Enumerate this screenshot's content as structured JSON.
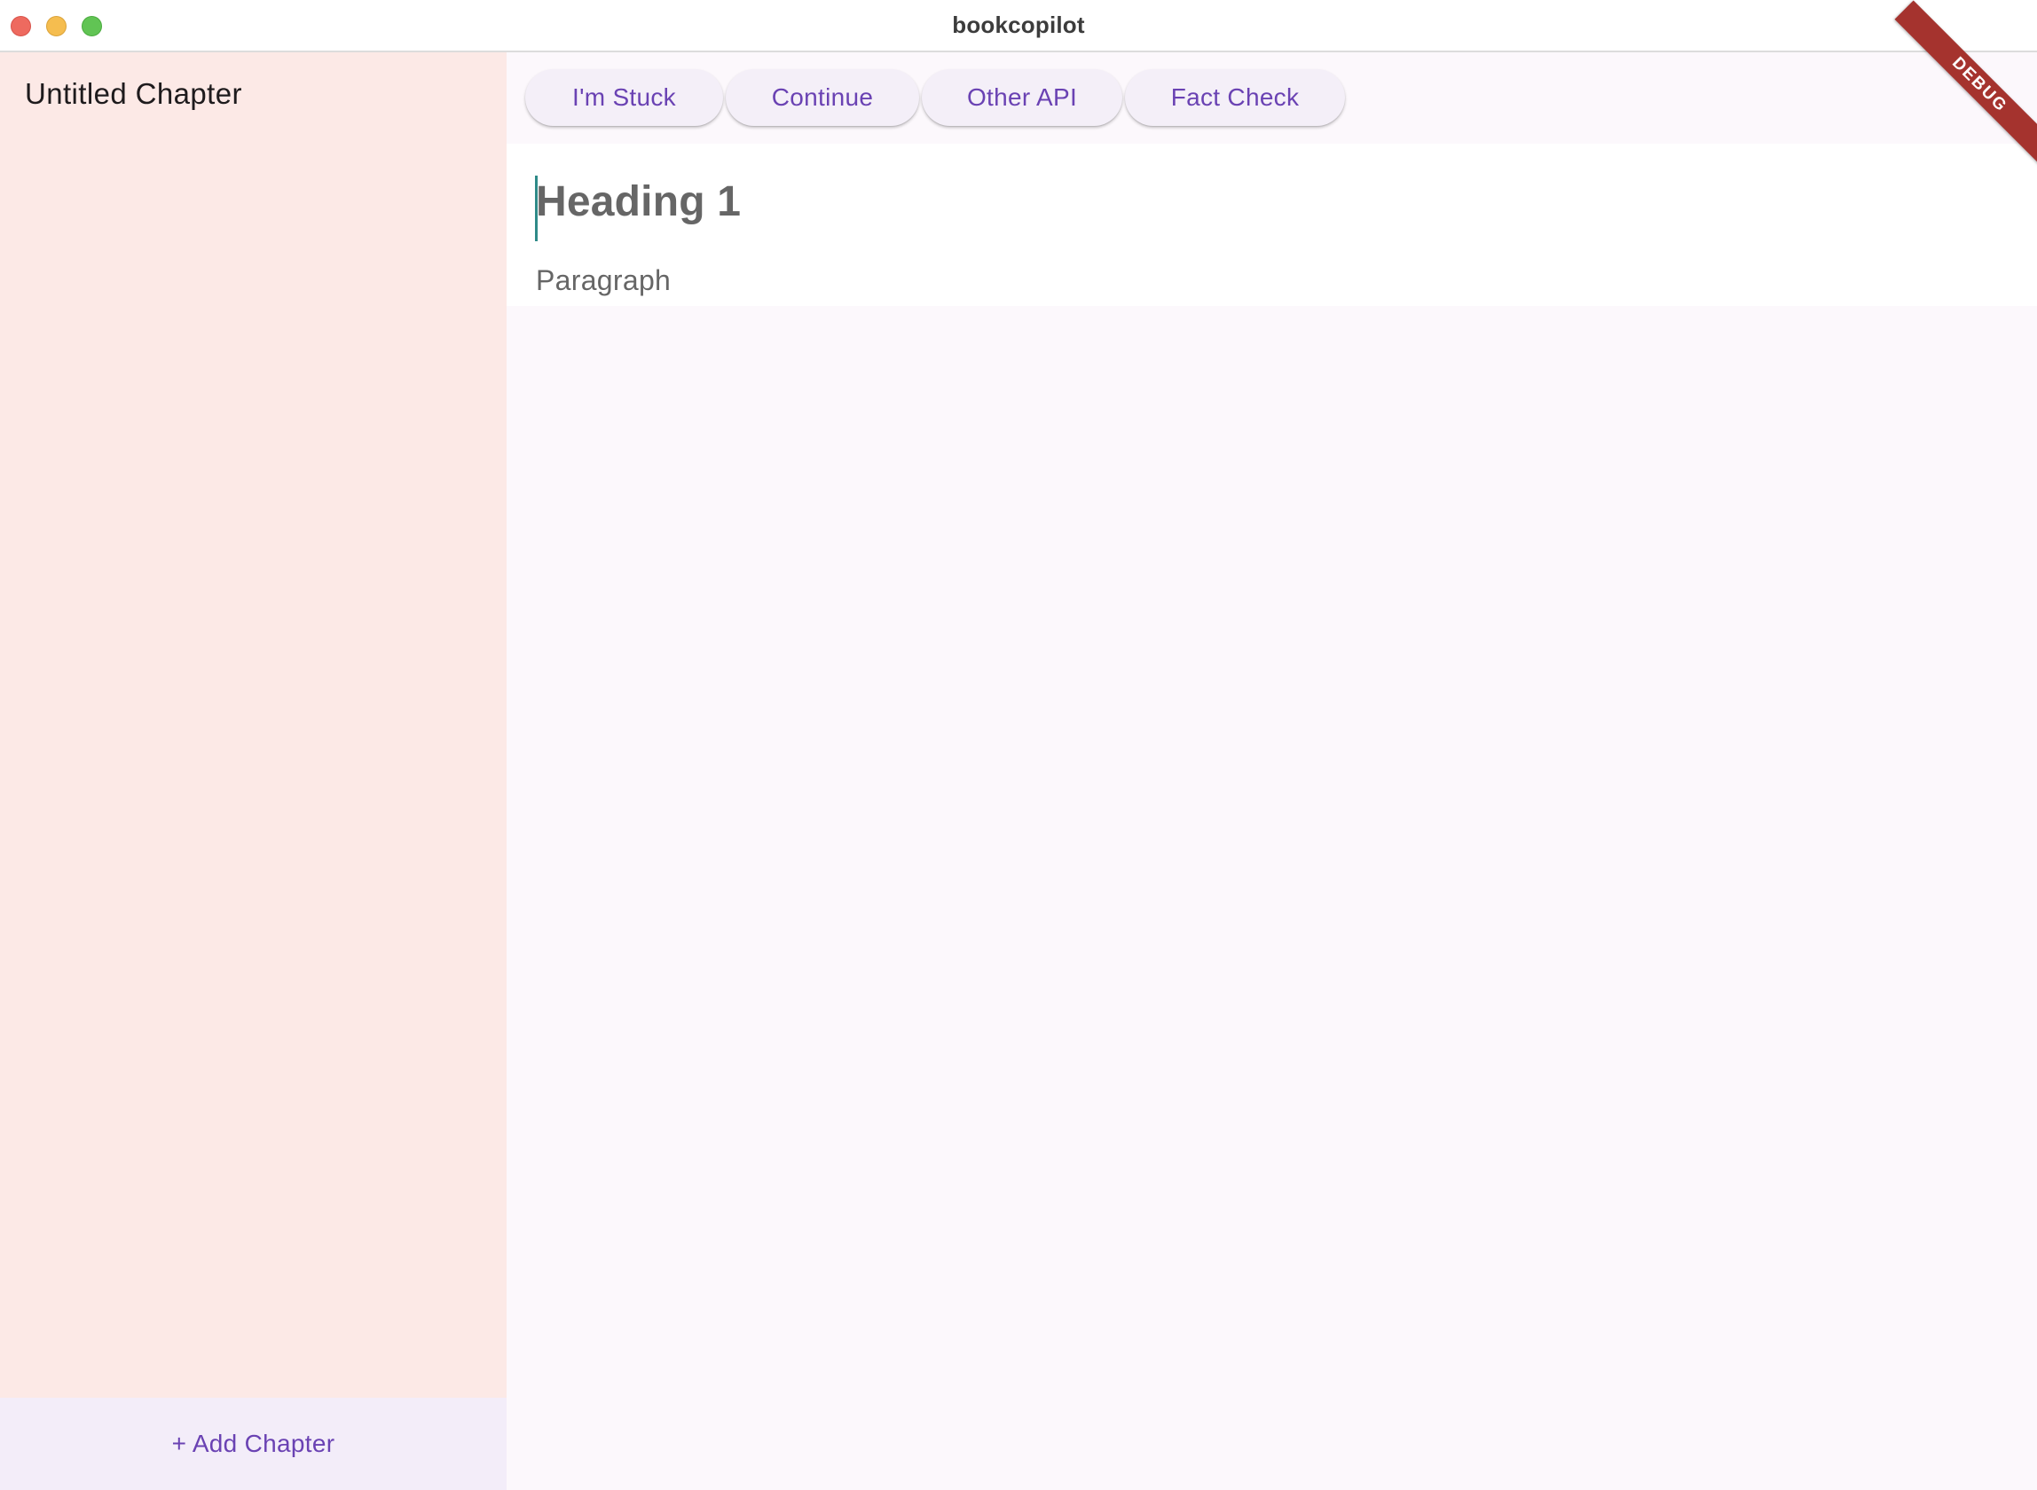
{
  "window": {
    "title": "bookcopilot"
  },
  "sidebar": {
    "chapters": [
      {
        "label": "Untitled Chapter"
      }
    ],
    "add_chapter_label": "+ Add Chapter"
  },
  "toolbar": {
    "buttons": [
      {
        "label": "I'm Stuck"
      },
      {
        "label": "Continue"
      },
      {
        "label": "Other API"
      },
      {
        "label": "Fact Check"
      }
    ]
  },
  "editor": {
    "heading": "Heading 1",
    "paragraph": "Paragraph"
  },
  "debug_banner": "DEBUG",
  "colors": {
    "accent": "#6a42b3",
    "sidebar_bg": "#fce9e6",
    "caret": "#2e8a88",
    "debug_ribbon": "#a5332e"
  }
}
